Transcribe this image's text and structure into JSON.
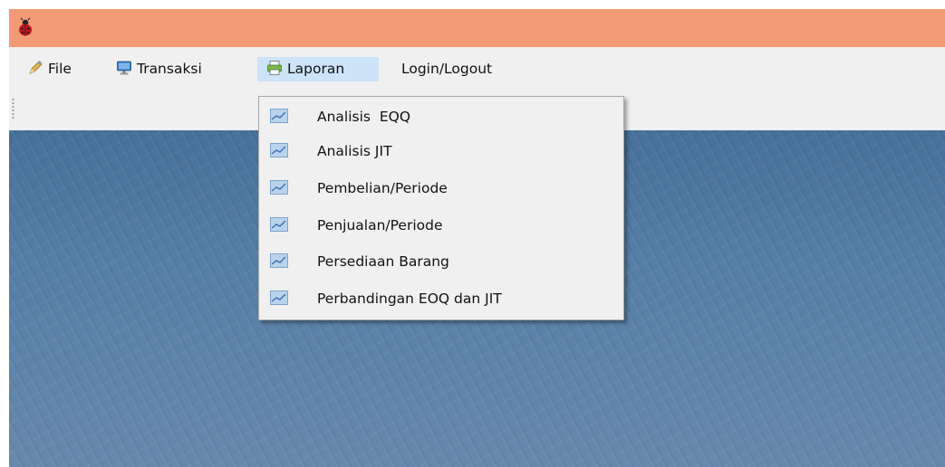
{
  "menubar": {
    "items": [
      {
        "label": "File",
        "icon": "pencil-icon"
      },
      {
        "label": "Transaksi",
        "icon": "monitor-icon"
      },
      {
        "label": "Laporan",
        "icon": "printer-icon"
      },
      {
        "label": "Login/Logout",
        "icon": ""
      }
    ],
    "active_item": "Laporan"
  },
  "laporan_menu": {
    "items": [
      {
        "label": "Analisis  EQQ",
        "icon": "chart-icon"
      },
      {
        "label": "Analisis JIT",
        "icon": "chart-icon"
      },
      {
        "label": "Pembelian/Periode",
        "icon": "chart-icon"
      },
      {
        "label": "Penjualan/Periode",
        "icon": "chart-icon"
      },
      {
        "label": "Persediaan Barang",
        "icon": "chart-icon"
      },
      {
        "label": "Perbandingan EOQ dan JIT",
        "icon": "chart-icon"
      }
    ]
  },
  "colors": {
    "titlebar": "#f29a75",
    "menu_highlight": "#cce3f8",
    "desktop": "#557fa6"
  }
}
